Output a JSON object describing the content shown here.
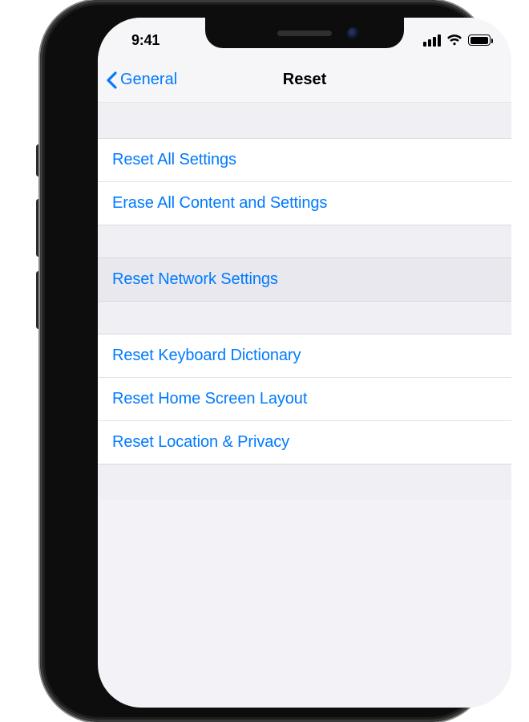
{
  "status": {
    "time": "9:41"
  },
  "nav": {
    "back_label": "General",
    "title": "Reset"
  },
  "groups": [
    {
      "items": [
        {
          "label": "Reset All Settings",
          "highlight": false
        },
        {
          "label": "Erase All Content and Settings",
          "highlight": false
        }
      ]
    },
    {
      "items": [
        {
          "label": "Reset Network Settings",
          "highlight": true
        }
      ]
    },
    {
      "items": [
        {
          "label": "Reset Keyboard Dictionary",
          "highlight": false
        },
        {
          "label": "Reset Home Screen Layout",
          "highlight": false
        },
        {
          "label": "Reset Location & Privacy",
          "highlight": false
        }
      ]
    }
  ]
}
